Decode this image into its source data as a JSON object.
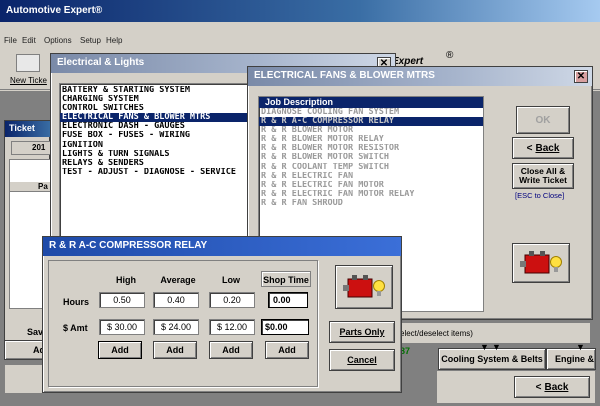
{
  "main_window": {
    "title": "Automotive Expert®",
    "menu": [
      "File",
      "Edit",
      "Options",
      "Setup",
      "Help"
    ],
    "new_ticket_label": "New Ticke",
    "brand_text": "Expert",
    "registered_mark": "®",
    "ticket_panel_title": "Ticket",
    "ticket_tab": "201",
    "col_header": "Pa",
    "save_label": "Sav",
    "add_label": "Ad",
    "status_hint": "elect/deselect items)",
    "status_number": "87",
    "tabs": [
      "Cooling System & Belts",
      "Engine &"
    ],
    "back_label": "Back"
  },
  "electrical_window": {
    "title": "Electrical & Lights",
    "categories": [
      "BATTERY & STARTING SYSTEM",
      "CHARGING SYSTEM",
      "CONTROL SWITCHES",
      "ELECTRICAL FANS & BLOWER MTRS",
      "ELECTRONIC DASH - GAUGES",
      "FUSE BOX - FUSES - WIRING",
      "IGNITION",
      "LIGHTS & TURN SIGNALS",
      "RELAYS & SENDERS",
      "TEST - ADJUST - DIAGNOSE - SERVICE"
    ],
    "selected_index": 3
  },
  "fans_window": {
    "title": "ELECTRICAL FANS & BLOWER MTRS",
    "list_header": "Job Description",
    "jobs": [
      "DIAGNOSE COOLING FAN SYSTEM",
      "R & R A-C COMPRESSOR RELAY",
      "R & R BLOWER MOTOR",
      "R & R BLOWER MOTOR RELAY",
      "R & R BLOWER MOTOR RESISTOR",
      "R & R BLOWER MOTOR SWITCH",
      "R & R COOLANT TEMP SWITCH",
      "R & R ELECTRIC FAN",
      "R & R ELECTRIC FAN MOTOR",
      "R & R ELECTRIC FAN MOTOR RELAY",
      "R & R FAN SHROUD"
    ],
    "selected_index": 1,
    "ok_label": "OK",
    "back_label": "Back",
    "close_all_label": "Close All &\nWrite Ticket",
    "esc_hint": "[ESC to Close]"
  },
  "relay_dialog": {
    "title": "R & R A-C COMPRESSOR RELAY",
    "col_high": "High",
    "col_average": "Average",
    "col_low": "Low",
    "col_shop_time": "Shop Time",
    "row_hours": "Hours",
    "row_amt": "$ Amt",
    "hours": {
      "high": "0.50",
      "average": "0.40",
      "low": "0.20",
      "shop": "0.00"
    },
    "amounts": {
      "high": "$ 30.00",
      "average": "$ 24.00",
      "low": "$ 12.00",
      "shop": "$0.00"
    },
    "add_label": "Add",
    "parts_only_label": "Parts Only",
    "cancel_label": "Cancel"
  }
}
